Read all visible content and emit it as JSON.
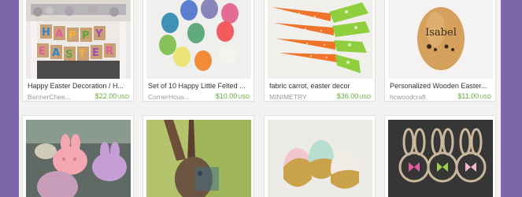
{
  "listings": [
    {
      "title": "Happy Easter Decoration / H...",
      "shop": "BannerChee...",
      "price": "$22.00",
      "currency": "USD",
      "banner_letters": [
        "H",
        "A",
        "P",
        "P",
        "Y",
        "E",
        "A",
        "S",
        "T",
        "E",
        "R"
      ]
    },
    {
      "title": "Set of 10 Happy Little Felted ...",
      "shop": "CornerHous...",
      "price": "$10.00",
      "currency": "USD"
    },
    {
      "title": "fabric carrot, easter decor",
      "shop": "MINIMETRY",
      "price": "$36.00",
      "currency": "USD"
    },
    {
      "title": "Personalized Wooden Easter...",
      "shop": "hcwoodcraft",
      "price": "$11.00",
      "currency": "USD",
      "egg_text": "Isabel"
    }
  ],
  "row2": [
    {
      "name": "soap-bunnies"
    },
    {
      "name": "rabbit-painting"
    },
    {
      "name": "gold-dipped-eggs"
    },
    {
      "name": "bunny-wreaths"
    }
  ],
  "colors": {
    "background": "#7d67aa",
    "panel": "#f3f2f0",
    "price": "#66a83c",
    "shop": "#9a9a9a",
    "title": "#333333"
  }
}
